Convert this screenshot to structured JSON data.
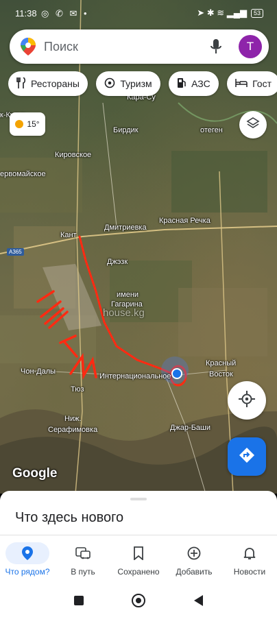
{
  "status_bar": {
    "time": "11:38",
    "left_icons": "◎ ✆ ✉ •",
    "right_icons": "➤ ✱ ≋ ▂▄▆",
    "battery": "53"
  },
  "search": {
    "placeholder": "Поиск",
    "avatar_letter": "Т"
  },
  "chips": [
    {
      "label": "Рестораны",
      "icon": "fork-knife-icon"
    },
    {
      "label": "Туризм",
      "icon": "camera-icon"
    },
    {
      "label": "АЗС",
      "icon": "gas-station-icon"
    },
    {
      "label": "Гост",
      "icon": "bed-icon"
    }
  ],
  "weather": {
    "temperature": "15°"
  },
  "map_labels": {
    "kara_su": "Кара-Су",
    "kuduk": "к-Кудук",
    "birdik": "Бирдик",
    "otegen": "отеген",
    "kirovskoe": "Кировское",
    "pervomayskoe": "ервомайское",
    "kant": "Кант",
    "dmitrievka": "Дмитриевка",
    "krasnaya_rechka": "Красная Речка",
    "road": "A365",
    "dzhal": "Джэзк",
    "imeni_gagarina_1": "имени",
    "imeni_gagarina_2": "Гагарина",
    "krasny_vostok_1": "Красный",
    "krasny_vostok_2": "Восток",
    "chon_daly": "Чон-Далы",
    "internatsionalnoe": "Интернациональное",
    "tyuz": "Тюз",
    "nizh": "Ниж.",
    "serafimovka": "Серафимовка",
    "dzhar_bashi": "Джар-Баши",
    "watermark": "house.kg",
    "handwritten": "11 км"
  },
  "map_logo": "Google",
  "sheet": {
    "title": "Что здесь нового"
  },
  "bottom_nav": [
    {
      "label": "Что рядом?",
      "icon": "location-pin-icon",
      "active": true
    },
    {
      "label": "В путь",
      "icon": "commute-icon",
      "active": false
    },
    {
      "label": "Сохранено",
      "icon": "bookmark-icon",
      "active": false
    },
    {
      "label": "Добавить",
      "icon": "add-circle-icon",
      "active": false
    },
    {
      "label": "Новости",
      "icon": "bell-icon",
      "active": false
    }
  ],
  "colors": {
    "accent": "#1a73e8",
    "avatar": "#8e24aa",
    "annotation": "#ff2a12"
  }
}
